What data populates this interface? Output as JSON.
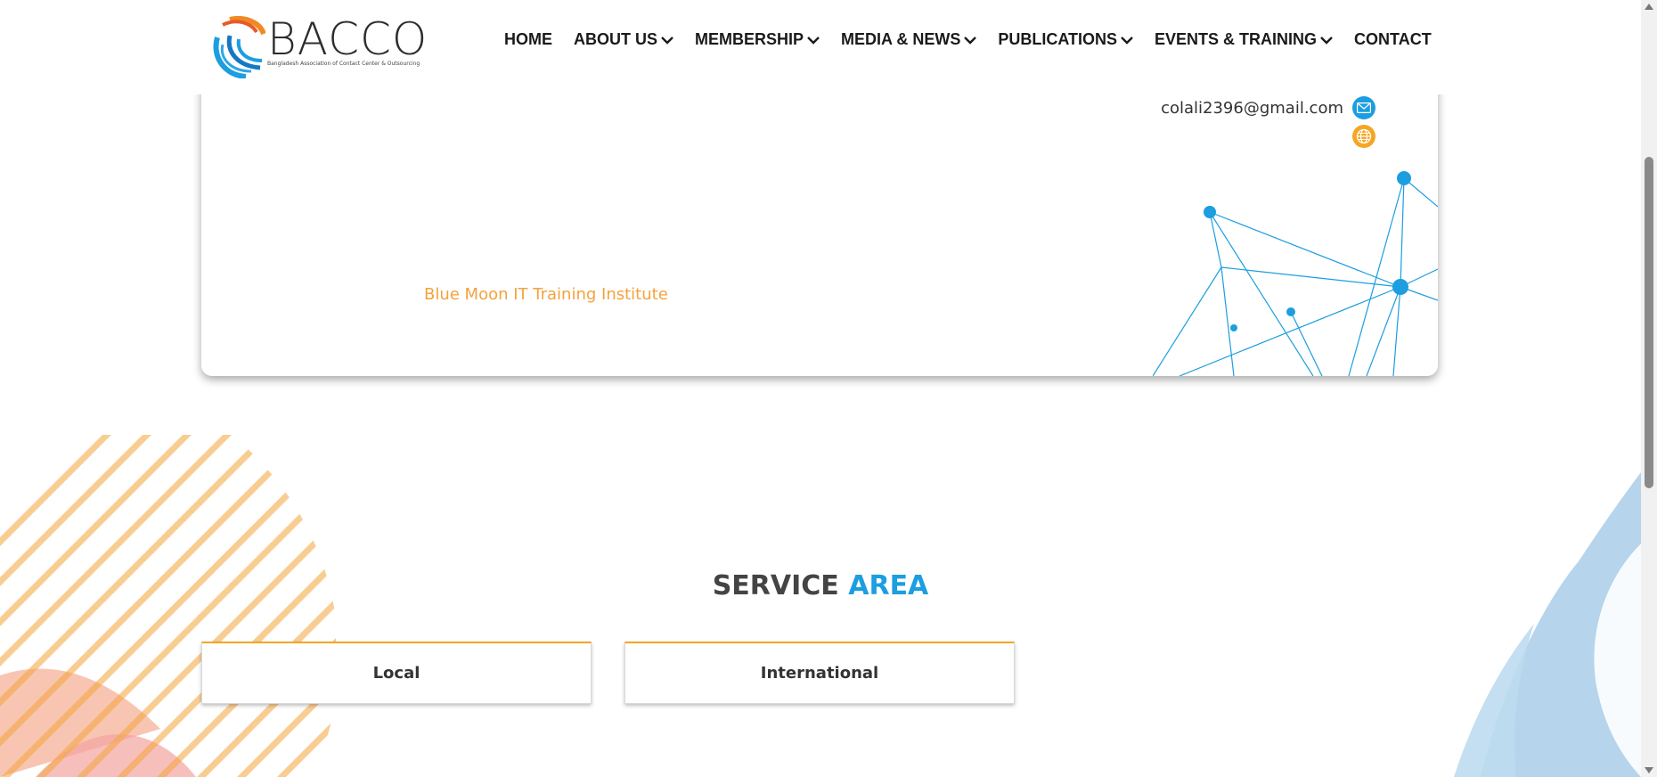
{
  "header": {
    "logo": {
      "word": "BACCO",
      "tagline": "Bangladesh Association of Contact Center & Outsourcing"
    },
    "nav": [
      {
        "label": "HOME",
        "has_dropdown": false
      },
      {
        "label": "ABOUT US",
        "has_dropdown": true
      },
      {
        "label": "MEMBERSHIP",
        "has_dropdown": true
      },
      {
        "label": "MEDIA & NEWS",
        "has_dropdown": true
      },
      {
        "label": "PUBLICATIONS",
        "has_dropdown": true
      },
      {
        "label": "EVENTS & TRAINING",
        "has_dropdown": true
      },
      {
        "label": "CONTACT",
        "has_dropdown": false
      }
    ]
  },
  "member_card": {
    "name": "Blue Moon IT Training Institute",
    "email": "colali2396@gmail.com",
    "icons": {
      "email": "envelope-icon",
      "website": "globe-icon"
    }
  },
  "service_area": {
    "title_part1": "SERVICE",
    "title_part2": "AREA",
    "options": [
      "Local",
      "International"
    ]
  },
  "colors": {
    "primary_blue": "#1c9ee0",
    "accent_orange": "#f5a623",
    "text_dark": "#333333"
  }
}
